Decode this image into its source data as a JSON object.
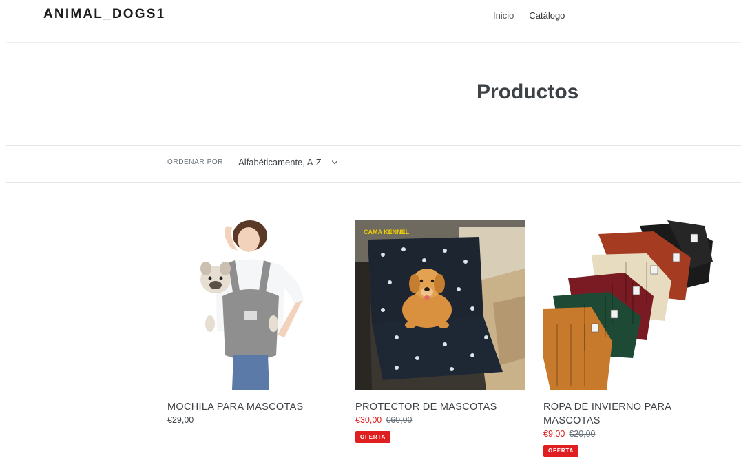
{
  "header": {
    "logo": "ANIMAL_DOGS1",
    "nav": [
      {
        "label": "Inicio"
      },
      {
        "label": "Catálogo"
      }
    ]
  },
  "collection": {
    "title": "Productos",
    "sort": {
      "label": "ORDENAR POR",
      "selected": "Alfabéticamente, A-Z"
    }
  },
  "products": [
    {
      "title": "MOCHILA PARA MASCOTAS",
      "price": "€29,00",
      "image_icon": "dog-carrier-backpack-photo"
    },
    {
      "title": "PROTECTOR DE MASCOTAS",
      "sale_price": "€30,00",
      "compare_price": "€60,00",
      "badge": "OFERTA",
      "image_text": "CAMA KENNEL",
      "image_icon": "car-seat-cover-photo"
    },
    {
      "title": "ROPA DE INVIERNO PARA MASCOTAS",
      "sale_price": "€9,00",
      "compare_price": "€20,00",
      "badge": "OFERTA",
      "image_icon": "knit-sweaters-photo"
    }
  ],
  "colors": {
    "sale": "#e02020",
    "text": "#3d4246"
  }
}
